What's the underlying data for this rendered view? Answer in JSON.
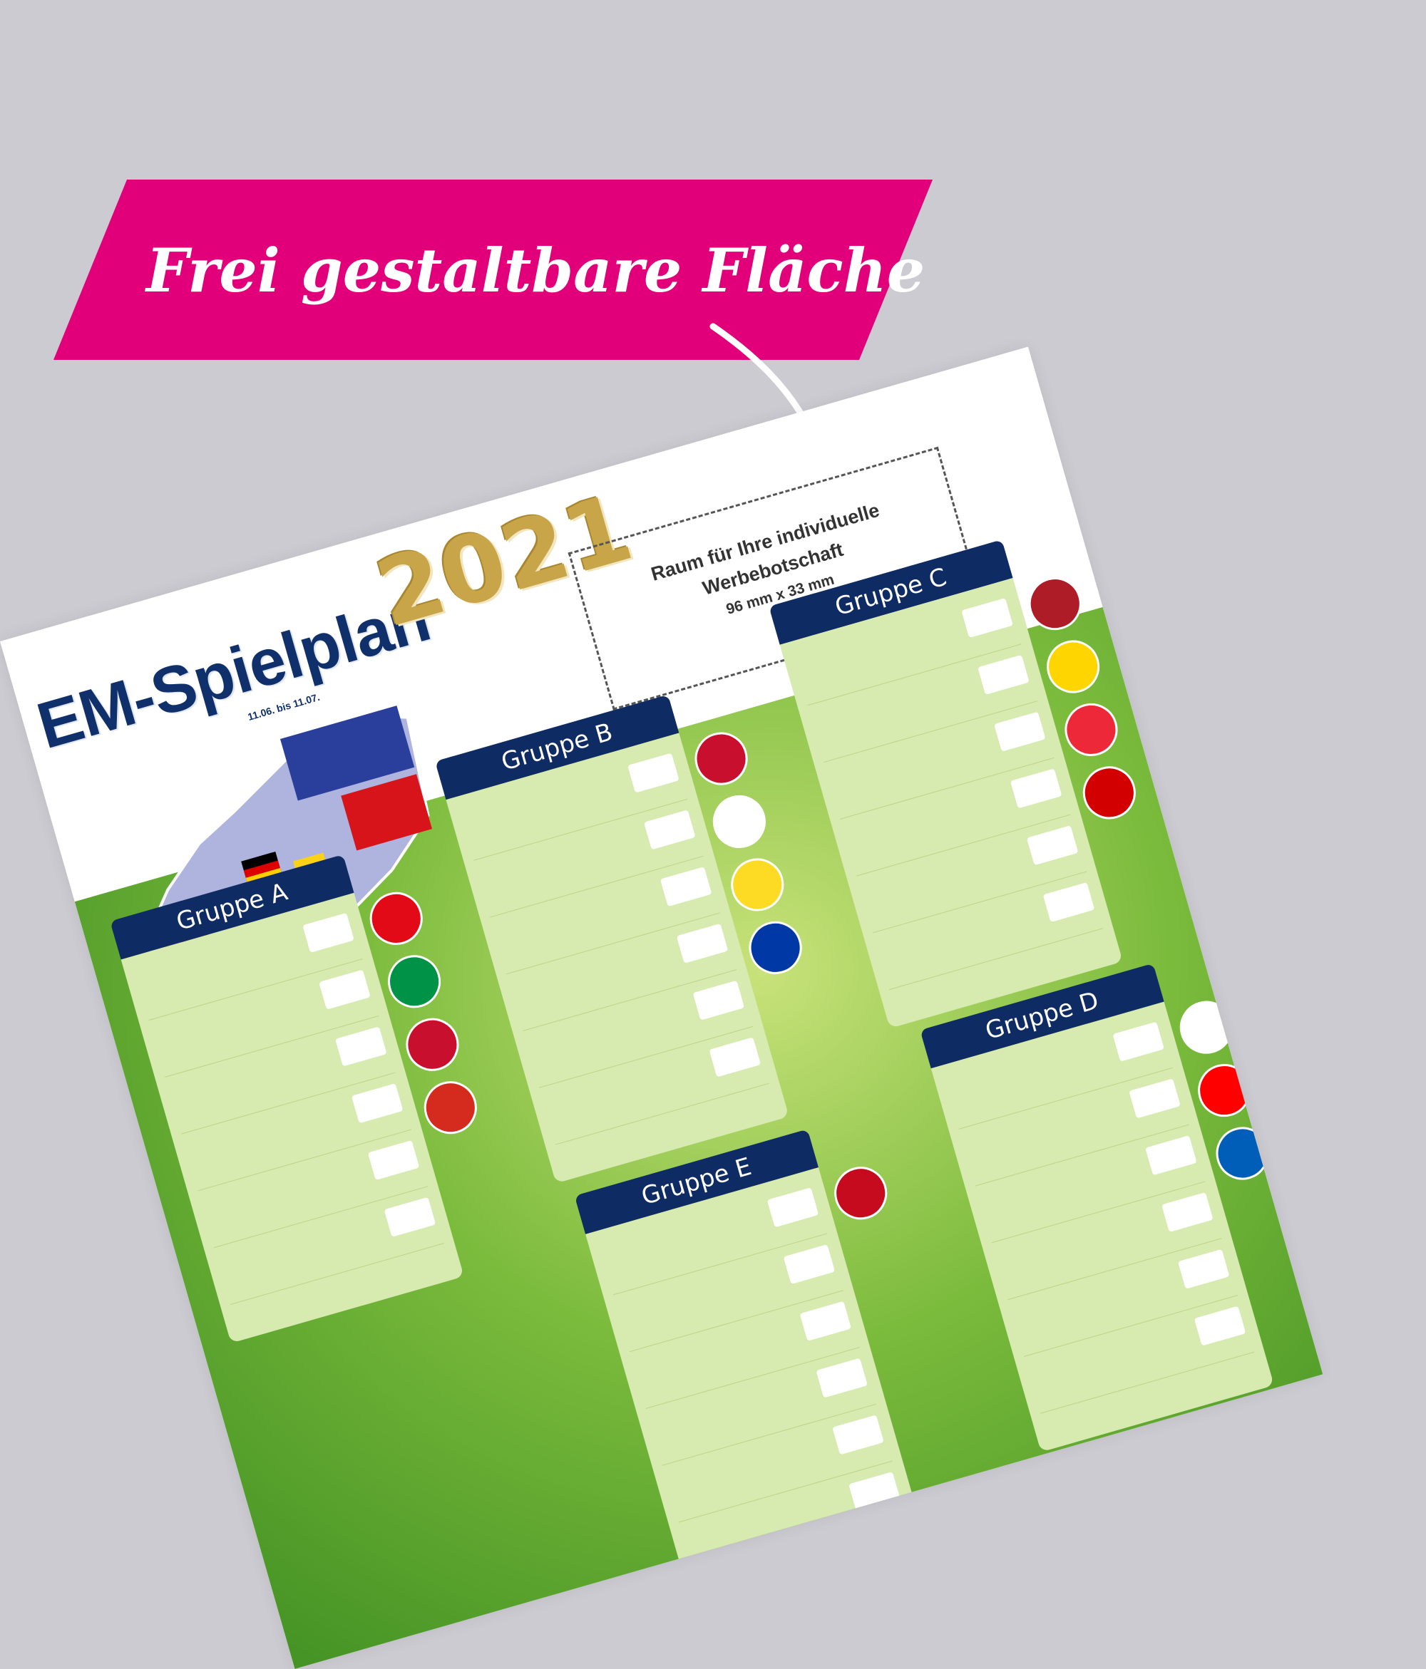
{
  "banner": {
    "text": "Frei gestaltbare Fläche",
    "color": "#e2007a"
  },
  "flyer": {
    "title": "EM-Spielplan",
    "year": "2021",
    "dates": "11.06. bis 11.07.",
    "adbox": {
      "line1": "Raum für Ihre individuelle",
      "line2": "Werbebotschaft",
      "line3": "96 mm x 33 mm"
    },
    "groups": [
      {
        "name": "Gruppe A",
        "flags": [
          "#e30a17",
          "#009246",
          "#c8102e",
          "#d52b1e"
        ]
      },
      {
        "name": "Gruppe B",
        "flags": [
          "#c8102e",
          "#ffffff",
          "#fdda24",
          "#0039a6"
        ]
      },
      {
        "name": "Gruppe C",
        "flags": [
          "#ae1c28",
          "#ffd500",
          "#ed2939",
          "#d20000"
        ]
      },
      {
        "name": "Gruppe D",
        "flags": [
          "#ffffff",
          "#ff0000",
          "#005eb8"
        ]
      },
      {
        "name": "Gruppe E",
        "flags": [
          "#c60b1e"
        ]
      }
    ]
  }
}
